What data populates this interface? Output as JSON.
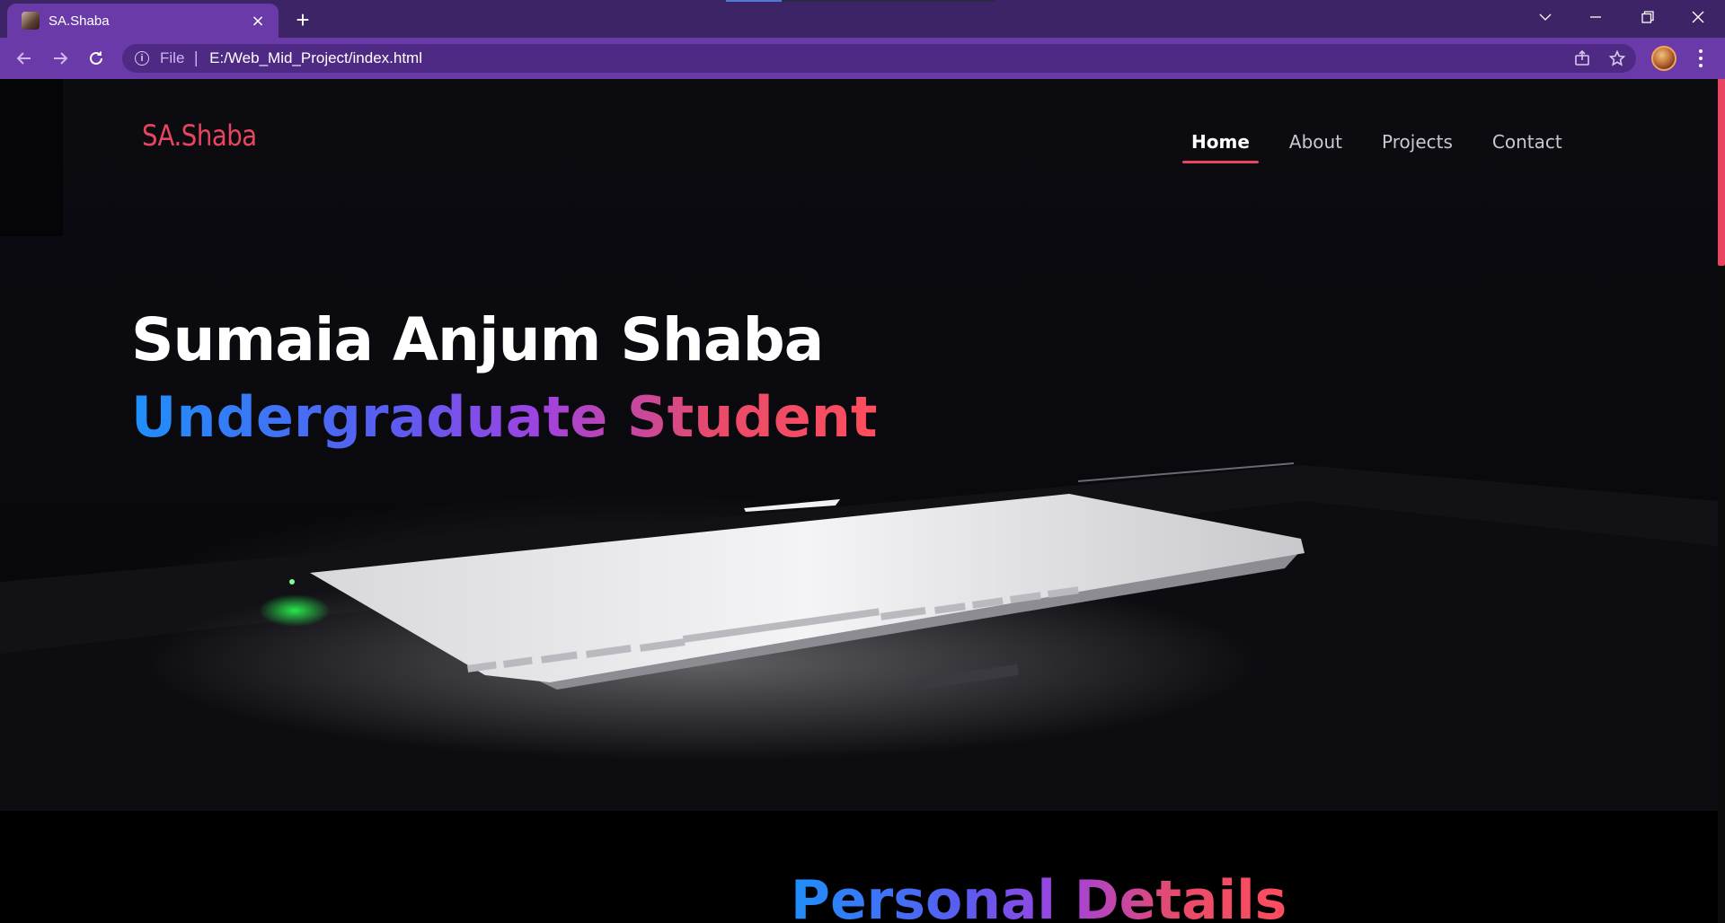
{
  "browser": {
    "tab_title": "SA.Shaba",
    "tab_close": "×",
    "new_tab": "+",
    "url_scheme": "File",
    "url_separator": "|",
    "url": "E:/Web_Mid_Project/index.html"
  },
  "site": {
    "logo": "SA.Shaba",
    "nav": [
      {
        "label": "Home",
        "active": true
      },
      {
        "label": "About",
        "active": false
      },
      {
        "label": "Projects",
        "active": false
      },
      {
        "label": "Contact",
        "active": false
      }
    ],
    "hero": {
      "name": "Sumaia Anjum Shaba",
      "role": "Undergraduate Student"
    },
    "section_title": "Personal Details"
  },
  "colors": {
    "accent": "#e84560",
    "chrome": "#6a3aa8",
    "tabstrip": "#3d2466",
    "gradient_start": "#1e8ffb",
    "gradient_end": "#ff4d5e"
  }
}
